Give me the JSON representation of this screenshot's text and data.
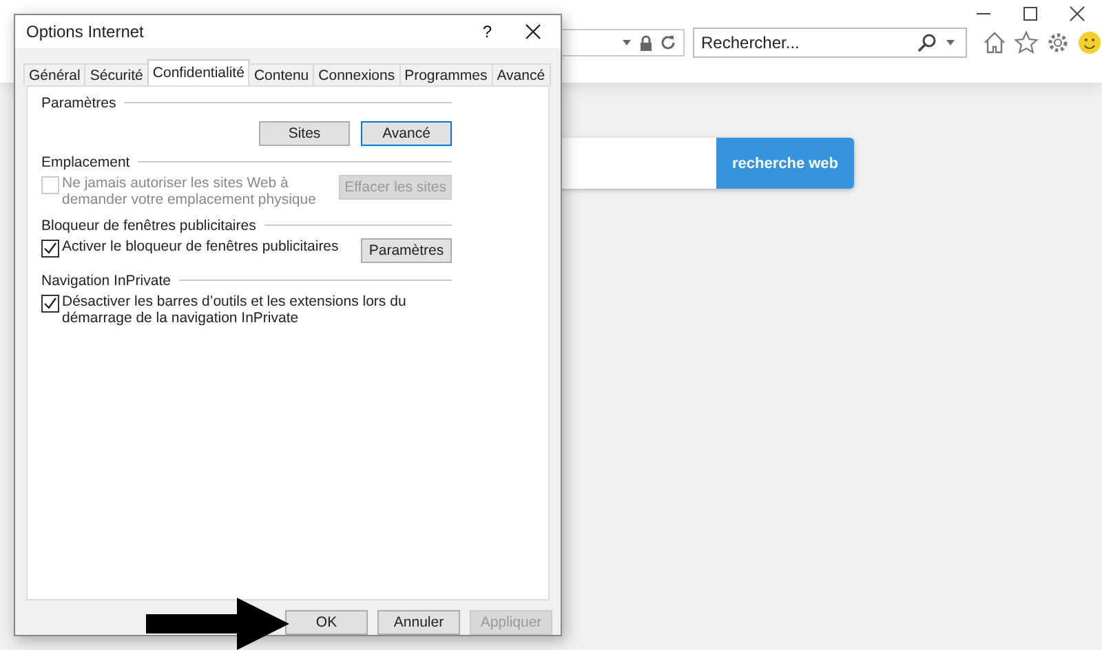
{
  "browser": {
    "search": {
      "placeholder": "Rechercher..."
    },
    "web_search_button": "recherche web"
  },
  "dialog": {
    "title": "Options Internet",
    "help": "?",
    "tabs": [
      {
        "label": "Général",
        "selected": false
      },
      {
        "label": "Sécurité",
        "selected": false
      },
      {
        "label": "Confidentialité",
        "selected": true
      },
      {
        "label": "Contenu",
        "selected": false
      },
      {
        "label": "Connexions",
        "selected": false
      },
      {
        "label": "Programmes",
        "selected": false
      },
      {
        "label": "Avancé",
        "selected": false
      }
    ],
    "sections": [
      {
        "heading": "Paramètres",
        "buttons": [
          {
            "label": "Sites",
            "disabled": false,
            "focused": false
          },
          {
            "label": "Avancé",
            "disabled": false,
            "focused": true
          }
        ]
      },
      {
        "heading": "Emplacement",
        "checkbox": {
          "label": "Ne jamais autoriser les sites Web à demander votre emplacement physique",
          "checked": false,
          "disabled": true
        },
        "buttons": [
          {
            "label": "Effacer les sites",
            "disabled": true,
            "focused": false
          }
        ]
      },
      {
        "heading": "Bloqueur de fenêtres publicitaires",
        "checkbox": {
          "label": "Activer le bloqueur de fenêtres publicitaires",
          "checked": true,
          "disabled": false
        },
        "buttons": [
          {
            "label": "Paramètres",
            "disabled": false,
            "focused": false
          }
        ]
      },
      {
        "heading": "Navigation InPrivate",
        "checkbox": {
          "label": "Désactiver les barres d’outils et les extensions lors du démarrage de la navigation InPrivate",
          "checked": true,
          "disabled": false
        }
      }
    ],
    "footer_buttons": [
      {
        "label": "OK",
        "disabled": false
      },
      {
        "label": "Annuler",
        "disabled": false
      },
      {
        "label": "Appliquer",
        "disabled": true
      }
    ]
  }
}
